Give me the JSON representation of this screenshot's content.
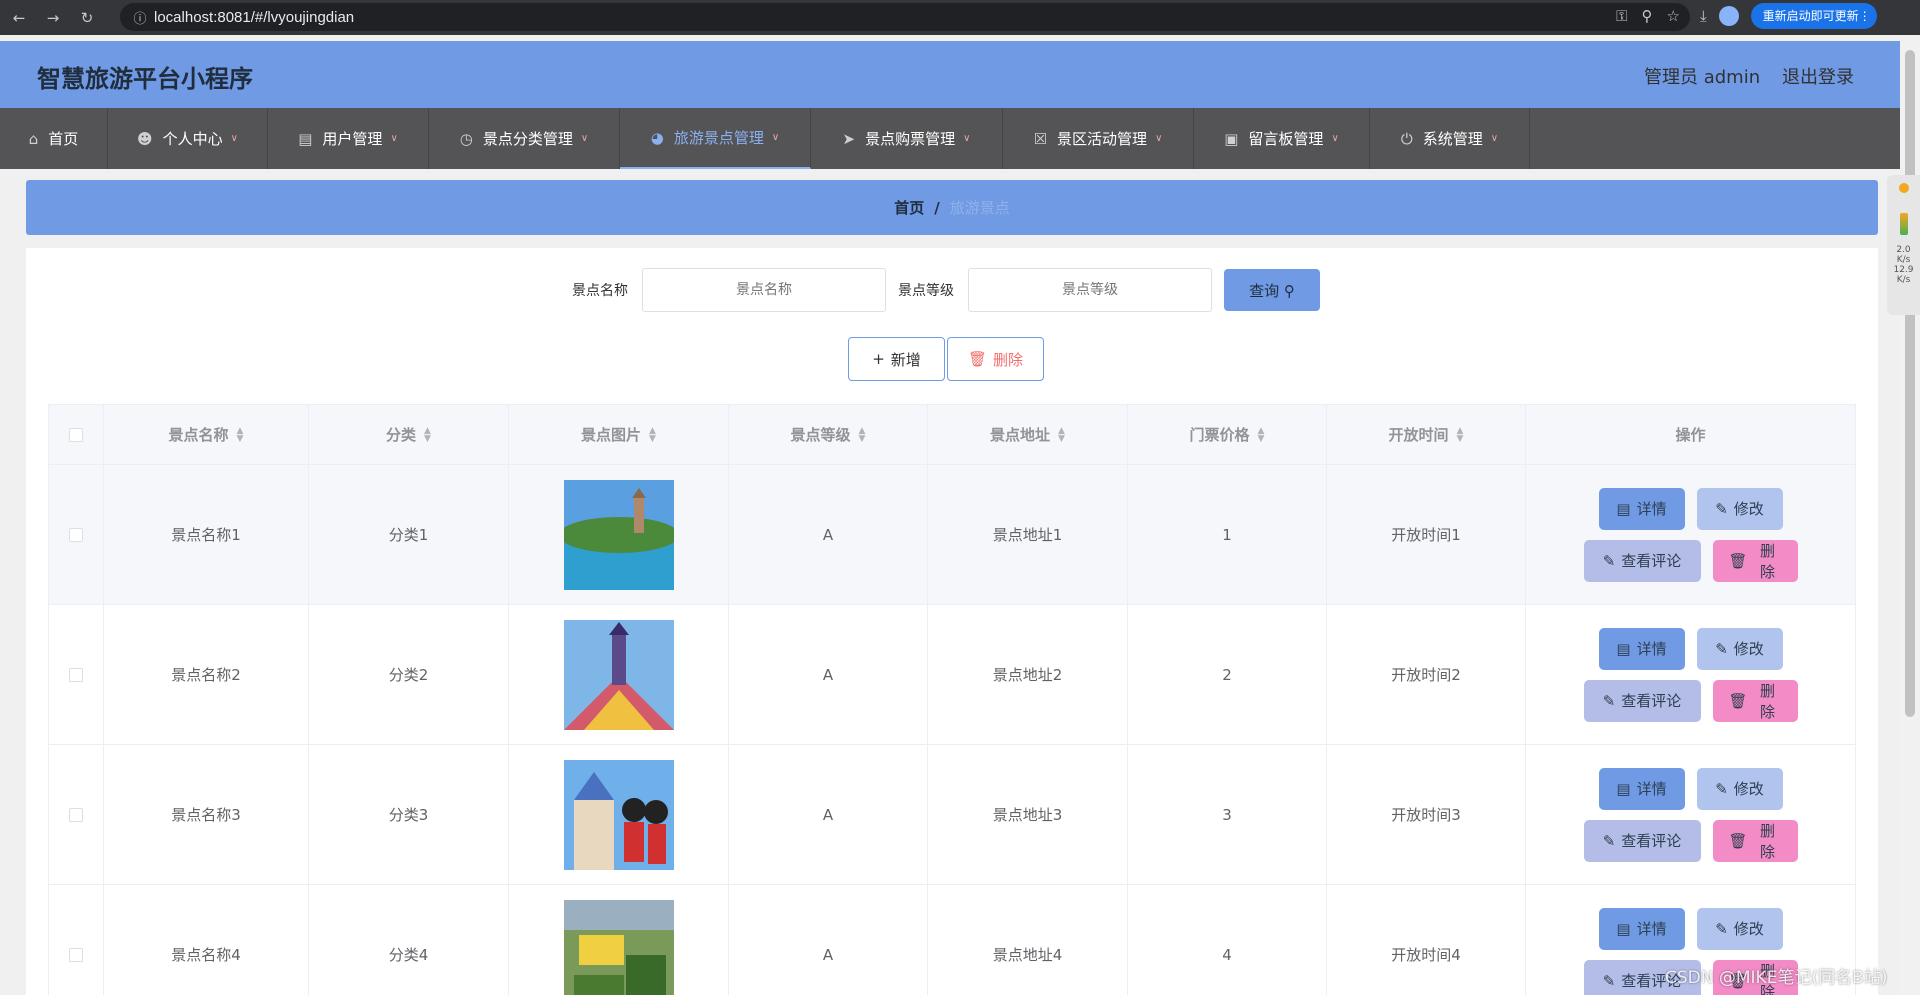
{
  "browser": {
    "url": "localhost:8081/#/lvyoujingdian",
    "update_label": "重新启动即可更新"
  },
  "header": {
    "title": "智慧旅游平台小程序",
    "user": "管理员 admin",
    "logout": "退出登录"
  },
  "menu": [
    {
      "label": "首页",
      "icon": "home-icon",
      "dropdown": false
    },
    {
      "label": "个人中心",
      "icon": "user-icon",
      "dropdown": true
    },
    {
      "label": "用户管理",
      "icon": "clipboard-icon",
      "dropdown": true
    },
    {
      "label": "景点分类管理",
      "icon": "clock-icon",
      "dropdown": true
    },
    {
      "label": "旅游景点管理",
      "icon": "compass-icon",
      "dropdown": true,
      "active": true
    },
    {
      "label": "景点购票管理",
      "icon": "send-icon",
      "dropdown": true
    },
    {
      "label": "景区活动管理",
      "icon": "delete-doc-icon",
      "dropdown": true
    },
    {
      "label": "留言板管理",
      "icon": "chart-icon",
      "dropdown": true
    },
    {
      "label": "系统管理",
      "icon": "power-icon",
      "dropdown": true
    }
  ],
  "breadcrumb": {
    "home": "首页",
    "separator": "/",
    "current": "旅游景点"
  },
  "search": {
    "name_label": "景点名称",
    "name_placeholder": "景点名称",
    "level_label": "景点等级",
    "level_placeholder": "景点等级",
    "query_label": "查询"
  },
  "actions": {
    "add_label": "新增",
    "delete_label": "删除"
  },
  "table": {
    "columns": [
      "景点名称",
      "分类",
      "景点图片",
      "景点等级",
      "景点地址",
      "门票价格",
      "开放时间",
      "操作"
    ],
    "buttons": {
      "detail": "详情",
      "edit": "修改",
      "comment": "查看评论",
      "delete": "删除"
    },
    "rows": [
      {
        "name": "景点名称1",
        "category": "分类1",
        "level": "A",
        "address": "景点地址1",
        "price": "1",
        "open_time": "开放时间1"
      },
      {
        "name": "景点名称2",
        "category": "分类2",
        "level": "A",
        "address": "景点地址2",
        "price": "2",
        "open_time": "开放时间2"
      },
      {
        "name": "景点名称3",
        "category": "分类3",
        "level": "A",
        "address": "景点地址3",
        "price": "3",
        "open_time": "开放时间3"
      },
      {
        "name": "景点名称4",
        "category": "分类4",
        "level": "A",
        "address": "景点地址4",
        "price": "4",
        "open_time": "开放时间4"
      }
    ]
  },
  "side_widget": {
    "up": "2.0",
    "up_unit": "K/s",
    "down": "12.9",
    "down_unit": "K/s"
  },
  "watermark": "CSDN @MIKE笔记(同名B站)",
  "colors": {
    "primary": "#719ae5",
    "menu_bg": "#545457",
    "danger": "#f56c6c",
    "delete_btn": "#f28bc6"
  }
}
